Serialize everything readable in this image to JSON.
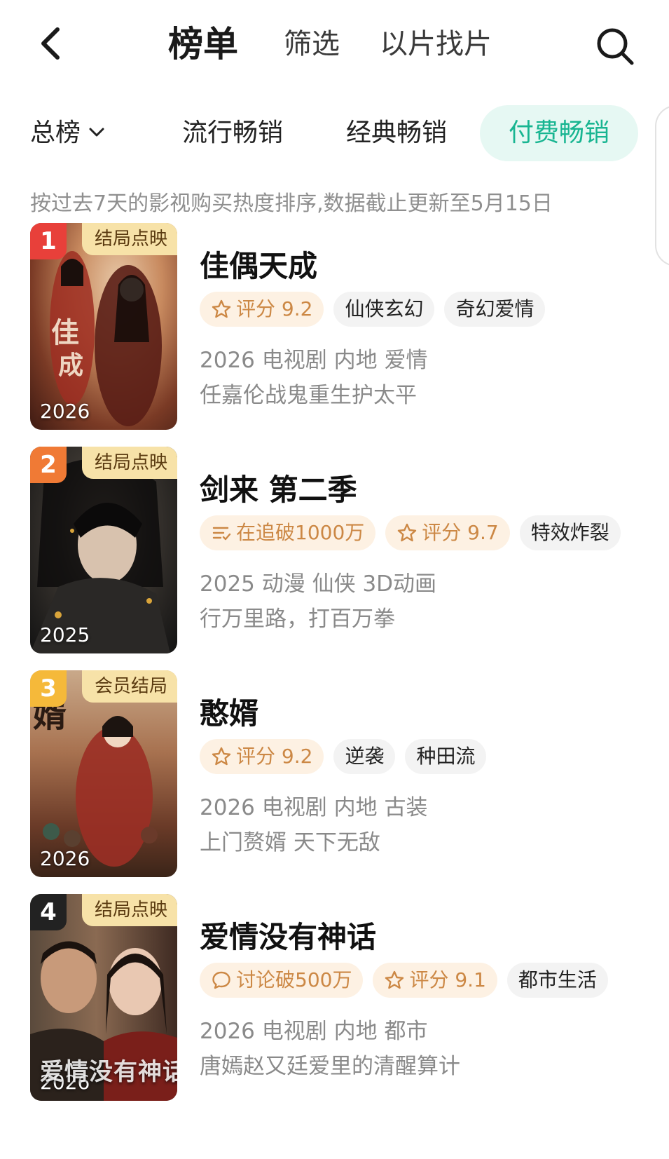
{
  "nav": {
    "tabs": [
      {
        "label": "榜单",
        "active": true
      },
      {
        "label": "筛选",
        "active": false
      },
      {
        "label": "以片找片",
        "active": false
      }
    ],
    "back_icon": "chevron-left-icon",
    "search_icon": "search-icon"
  },
  "categories": [
    {
      "label": "总榜",
      "has_dropdown": true,
      "active": false
    },
    {
      "label": "流行畅销",
      "active": false
    },
    {
      "label": "经典畅销",
      "active": false
    },
    {
      "label": "付费畅销",
      "active": true
    }
  ],
  "notice": "按过去7天的影视购买热度排序,数据截止更新至5月15日",
  "colors": {
    "accent": "#18b591",
    "accent_bg": "#e6f8f3",
    "rank_1": "#e8403a",
    "rank_2": "#f07a35",
    "rank_3": "#f5b93a",
    "rank_4": "#222222",
    "badge_bg": "#f7e2a8",
    "tag_orange": "#cc8845"
  },
  "items": [
    {
      "rank": "1",
      "badge": "结局点映",
      "year_overlay": "2026",
      "title": "佳偶天成",
      "tags": [
        {
          "icon": "star-icon",
          "text": "评分 9.2",
          "style": "orange"
        },
        {
          "text": "仙侠玄幻"
        },
        {
          "text": "奇幻爱情"
        }
      ],
      "meta": "2026 电视剧 内地 爱情",
      "desc": "任嘉伦战鬼重生护太平"
    },
    {
      "rank": "2",
      "badge": "结局点映",
      "year_overlay": "2025",
      "title": "剑来 第二季",
      "tags": [
        {
          "icon": "list-check-icon",
          "text": "在追破1000万",
          "style": "orange"
        },
        {
          "icon": "star-icon",
          "text": "评分 9.7",
          "style": "orange"
        },
        {
          "text": "特效炸裂"
        }
      ],
      "meta": "2025 动漫 仙侠 3D动画",
      "desc": "行万里路，打百万拳"
    },
    {
      "rank": "3",
      "badge": "会员结局",
      "year_overlay": "2026",
      "title": "憨婿",
      "tags": [
        {
          "icon": "star-icon",
          "text": "评分 9.2",
          "style": "orange"
        },
        {
          "text": "逆袭"
        },
        {
          "text": "种田流"
        }
      ],
      "meta": "2026 电视剧 内地 古装",
      "desc": "上门赘婿 天下无敌"
    },
    {
      "rank": "4",
      "badge": "结局点映",
      "year_overlay": "2026",
      "poster_title": "爱情没有神话",
      "title": "爱情没有神话",
      "tags": [
        {
          "icon": "chat-bubble-icon",
          "text": "讨论破500万",
          "style": "orange"
        },
        {
          "icon": "star-icon",
          "text": "评分 9.1",
          "style": "orange"
        },
        {
          "text": "都市生活"
        }
      ],
      "meta": "2026 电视剧 内地 都市",
      "desc": "唐嫣赵又廷爱里的清醒算计"
    }
  ]
}
